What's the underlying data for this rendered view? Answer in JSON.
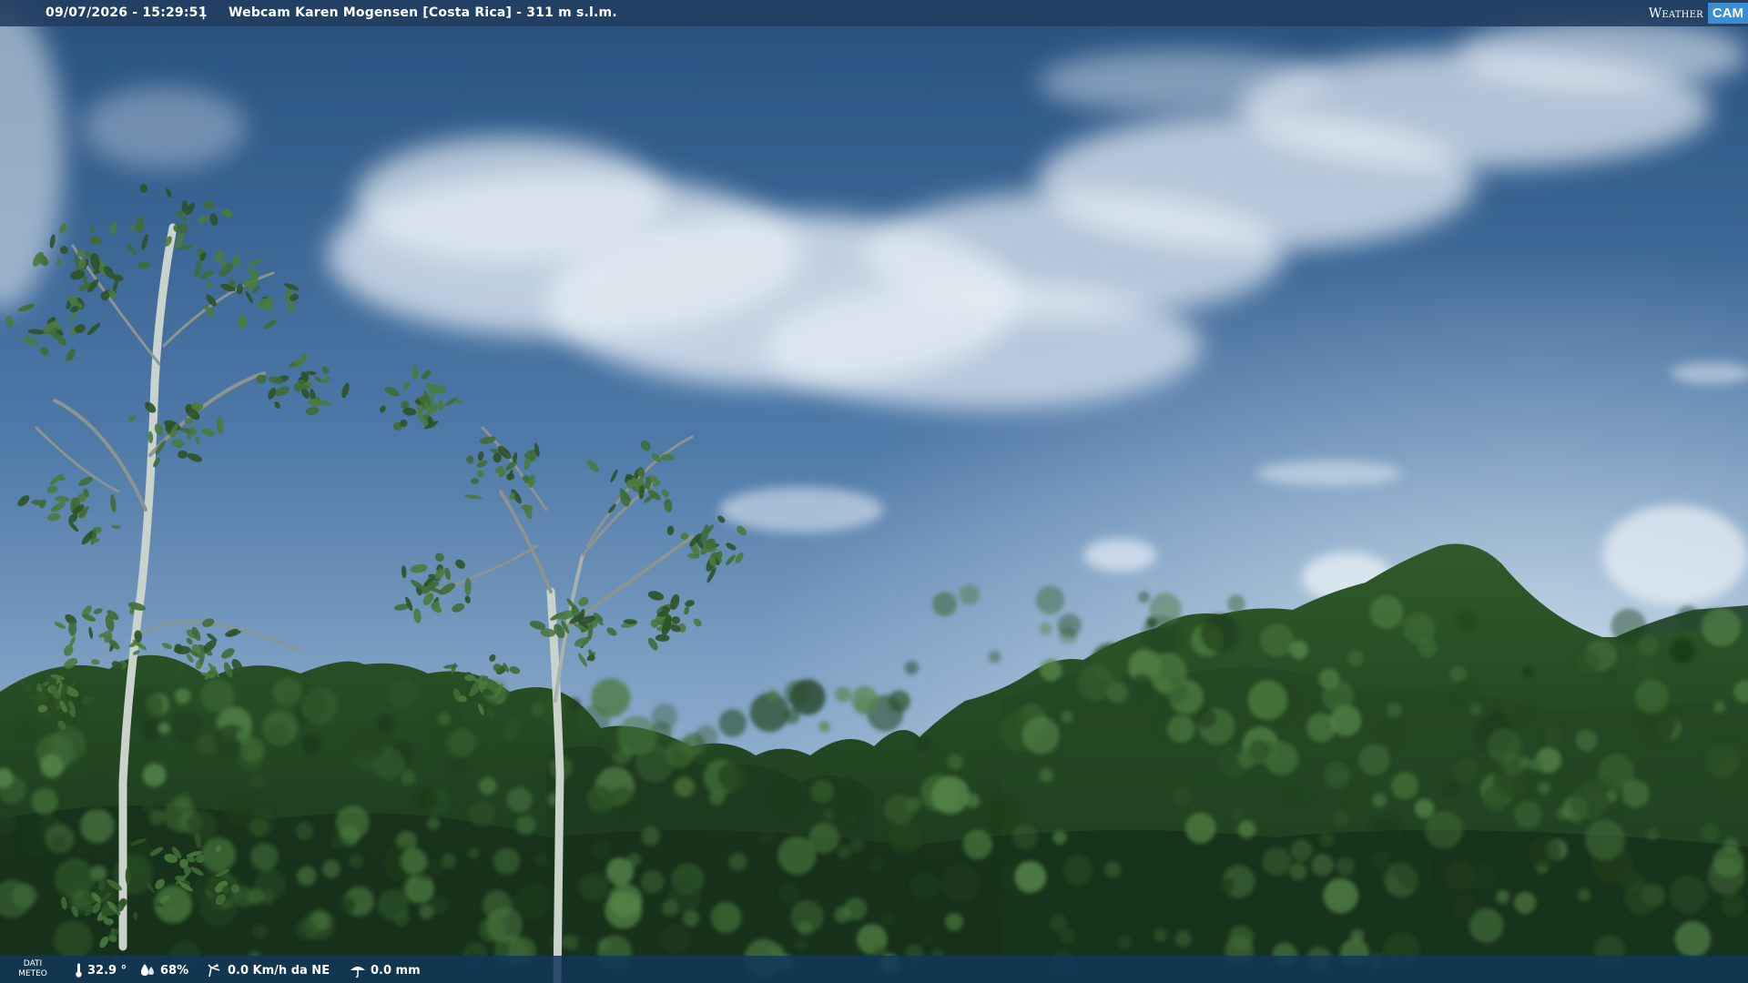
{
  "overlay": {
    "timestamp": "09/07/2026 - 15:29:51",
    "separator": "|",
    "camera_title": "Webcam Karen Mogensen [Costa Rica] - 311 m s.l.m.",
    "logo": {
      "weather": "Weather",
      "cam": "CAM"
    }
  },
  "weather_data": {
    "label_line1": "DATI",
    "label_line2": "METEO",
    "temperature": "32.9 °",
    "humidity": "68%",
    "wind": "0.0 Km/h da NE",
    "rain": "0.0 mm"
  },
  "icons": {
    "temperature": "thermometer-icon",
    "humidity": "droplet-icon",
    "wind": "wind-icon",
    "rain": "rain-cloud-icon"
  },
  "colors": {
    "top_bar": "#213e60",
    "bottom_bar": "#12375a",
    "logo_accent": "#3a8ed4",
    "sky_top": "#2a5284",
    "sky_horizon": "#a9c4dc",
    "foliage": "#1f3d1c"
  }
}
